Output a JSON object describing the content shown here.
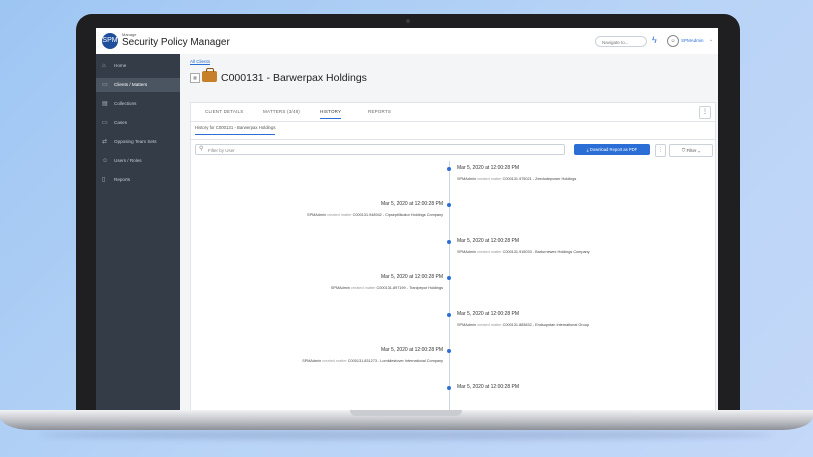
{
  "app": {
    "brand_small": "Manage",
    "brand": "Security Policy Manager",
    "logo_text": "SPM",
    "navigate_placeholder": "Navigate to...",
    "user_name": "SPMAdmin"
  },
  "sidebar": {
    "items": [
      {
        "label": "Home",
        "icon": "home-icon",
        "glyph": "⌂",
        "active": false
      },
      {
        "label": "Clients / Matters",
        "icon": "briefcase-icon",
        "glyph": "▭",
        "active": true
      },
      {
        "label": "Collections",
        "icon": "collections-icon",
        "glyph": "▤",
        "active": false
      },
      {
        "label": "Cases",
        "icon": "cases-icon",
        "glyph": "▭",
        "active": false
      },
      {
        "label": "Opposing Team Sets",
        "icon": "opposing-icon",
        "glyph": "⇄",
        "active": false
      },
      {
        "label": "Users / Roles",
        "icon": "users-icon",
        "glyph": "☺",
        "active": false
      },
      {
        "label": "Reports",
        "icon": "reports-icon",
        "glyph": "▯",
        "active": false
      }
    ]
  },
  "breadcrumb": "All Clients",
  "page": {
    "title": "C000131 - Barwerpax Holdings"
  },
  "tabs": [
    "CLIENT DETAILS",
    "MATTERS (3/48)",
    "HISTORY",
    "REPORTS"
  ],
  "active_tab": "HISTORY",
  "subtab": "History for C000131 - Barwerpax Holdings",
  "toolbar": {
    "filter_placeholder": "Filter by User",
    "download_label": "Download Report as PDF",
    "filter_label": "Filter"
  },
  "timeline": [
    {
      "side": "right",
      "date": "Mar 5, 2020 at 12:00:28 PM",
      "user": "SPMAdmin",
      "action": "created matter",
      "target": "C000131.975021 - Zeedudepower Holdings"
    },
    {
      "side": "left",
      "date": "Mar 5, 2020 at 12:00:28 PM",
      "user": "SPMAdmin",
      "action": "created matter",
      "target": "C000131.948942 - Cipseptillicator Holdings Company"
    },
    {
      "side": "right",
      "date": "Mar 5, 2020 at 12:00:28 PM",
      "user": "SPMAdmin",
      "action": "created matter",
      "target": "C000131.915033 - Barturnewex Holdings Company"
    },
    {
      "side": "left",
      "date": "Mar 5, 2020 at 12:00:28 PM",
      "user": "SPMAdmin",
      "action": "created matter",
      "target": "C000131.897199 - Tranipepor Holdings"
    },
    {
      "side": "right",
      "date": "Mar 5, 2020 at 12:00:28 PM",
      "user": "SPMAdmin",
      "action": "created matter",
      "target": "C000131.883832 - Endsupotan International Group"
    },
    {
      "side": "left",
      "date": "Mar 5, 2020 at 12:00:28 PM",
      "user": "SPMAdmin",
      "action": "created matter",
      "target": "C000131.831273 - Lomkilestover International Company"
    },
    {
      "side": "right",
      "date": "Mar 5, 2020 at 12:00:28 PM",
      "user": "",
      "action": "",
      "target": ""
    }
  ],
  "colors": {
    "accent": "#2b6fd6",
    "sidebar": "#333c47",
    "brand_icon": "#c77f2a"
  }
}
